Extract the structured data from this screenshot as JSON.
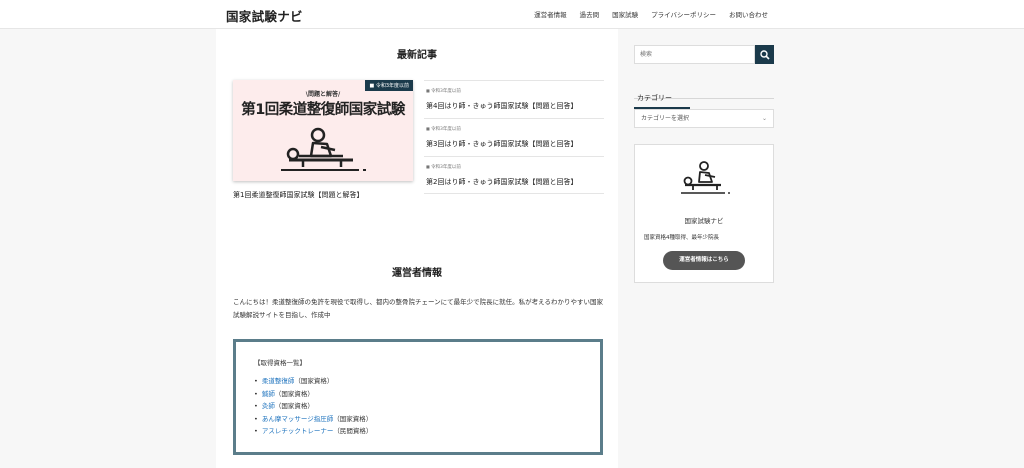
{
  "header": {
    "site_title": "国家試験ナビ",
    "nav": [
      "運営者情報",
      "過去問",
      "国家試験",
      "プライバシーポリシー",
      "お問い合わせ"
    ]
  },
  "main": {
    "latest_title": "最新記事",
    "featured": {
      "category_tag": "令和3年度以前",
      "thumb_sub": "\\問題と解答/",
      "thumb_title": "第1回柔道整復師国家試験",
      "title": "第1回柔道整復師国家試験【問題と解答】"
    },
    "articles": [
      {
        "category": "令和3年度以前",
        "title": "第4回はり師・きゅう師国家試験【問題と回答】"
      },
      {
        "category": "令和3年度以前",
        "title": "第3回はり師・きゅう師国家試験【問題と回答】"
      },
      {
        "category": "令和3年度以前",
        "title": "第2回はり師・きゅう師国家試験【問題と回答】"
      }
    ],
    "about_title": "運営者情報",
    "about_text": "こんにちは！柔道整復師の免許を現役で取得し、都内の整骨院チェーンにて最年少で院長に就任。私が考えるわかりやすい国家試験解説サイトを目指し、作成中",
    "quals": {
      "heading": "【取得資格一覧】",
      "items": [
        {
          "link": "柔道整復師",
          "note": "（国家資格）"
        },
        {
          "link": "鍼師",
          "note": "（国家資格）"
        },
        {
          "link": "灸師",
          "note": "（国家資格）"
        },
        {
          "link": "あん摩マッサージ指圧師",
          "note": "（国家資格）"
        },
        {
          "link": "アスレチックトレーナー",
          "note": "（民間資格）"
        }
      ]
    }
  },
  "sidebar": {
    "search_placeholder": "検索",
    "category_title": "カテゴリー",
    "category_select": "カテゴリーを選択",
    "profile_name": "国家試験ナビ",
    "profile_desc": "国家資格4種取得、最年少院長",
    "profile_button": "運営者情報はこちら"
  },
  "icons": {
    "search": "search-icon",
    "folder": "folder-icon",
    "chevron": "chevron-down-icon"
  },
  "colors": {
    "accent": "#1b3a4b",
    "link": "#1e73be",
    "thumb_bg": "#fdecec",
    "box_border": "#5b7d8a"
  }
}
